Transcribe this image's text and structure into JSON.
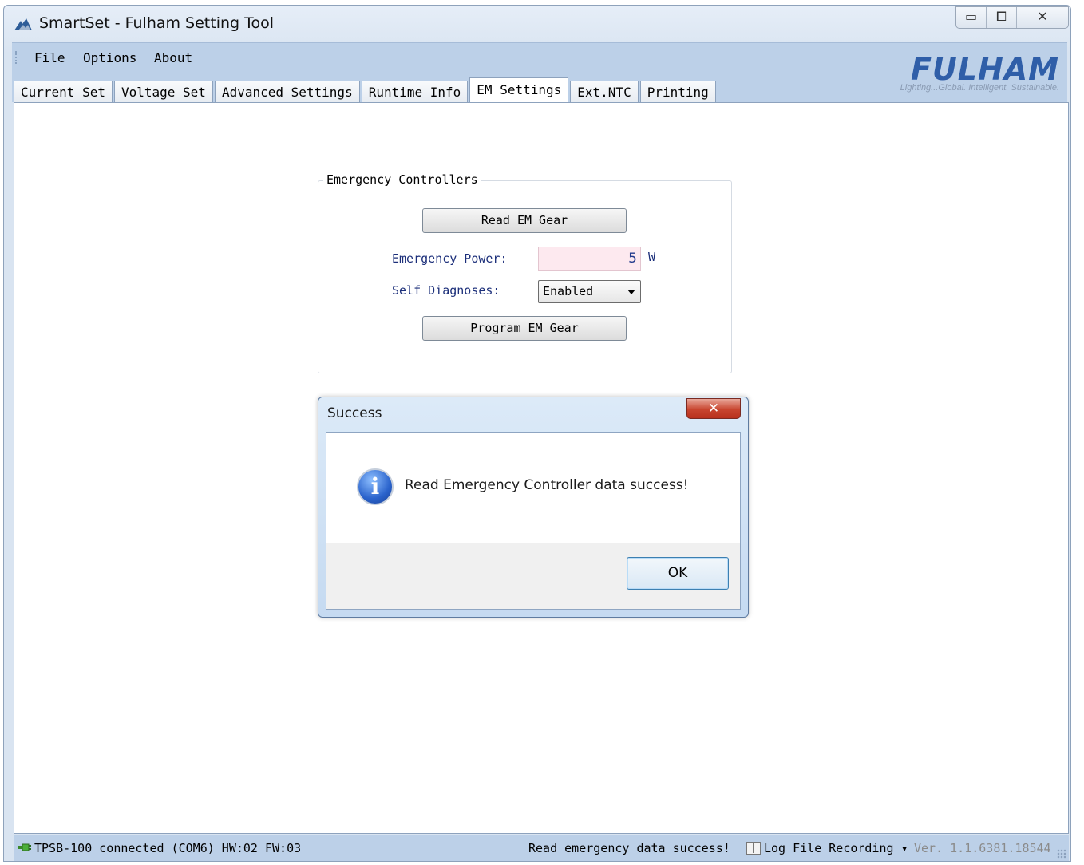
{
  "window": {
    "title": "SmartSet - Fulham Setting Tool",
    "controls": {
      "minimize": "▭",
      "maximize": "⧠",
      "close": "✕"
    }
  },
  "menu": {
    "items": [
      "File",
      "Options",
      "About"
    ]
  },
  "logo": {
    "main": "FULHAM",
    "tagline": "Lighting...Global. Intelligent. Sustainable."
  },
  "tabs": [
    {
      "label": "Current Set",
      "active": false
    },
    {
      "label": "Voltage Set",
      "active": false
    },
    {
      "label": "Advanced Settings",
      "active": false
    },
    {
      "label": "Runtime Info",
      "active": false
    },
    {
      "label": "EM Settings",
      "active": true
    },
    {
      "label": "Ext.NTC",
      "active": false
    },
    {
      "label": "Printing",
      "active": false
    }
  ],
  "em": {
    "group_title": "Emergency Controllers",
    "read_button": "Read EM Gear",
    "power_label": "Emergency Power:",
    "power_value": "5",
    "power_unit": "W",
    "diag_label": "Self Diagnoses:",
    "diag_value": "Enabled",
    "program_button": "Program EM Gear"
  },
  "dialog": {
    "title": "Success",
    "close": "✕",
    "message": "Read Emergency Controller data success!",
    "ok": "OK",
    "icon": "info-icon"
  },
  "status": {
    "connection": "TPSB-100 connected (COM6) HW:02 FW:03",
    "message": "Read emergency data success!",
    "log": "Log File Recording ▾",
    "version": "Ver. 1.1.6381.18544"
  },
  "colors": {
    "accent": "#2f5ea8",
    "menubar": "#bcd0e8",
    "input_bg": "#fde9ef",
    "dialog_close": "#c8452f"
  }
}
